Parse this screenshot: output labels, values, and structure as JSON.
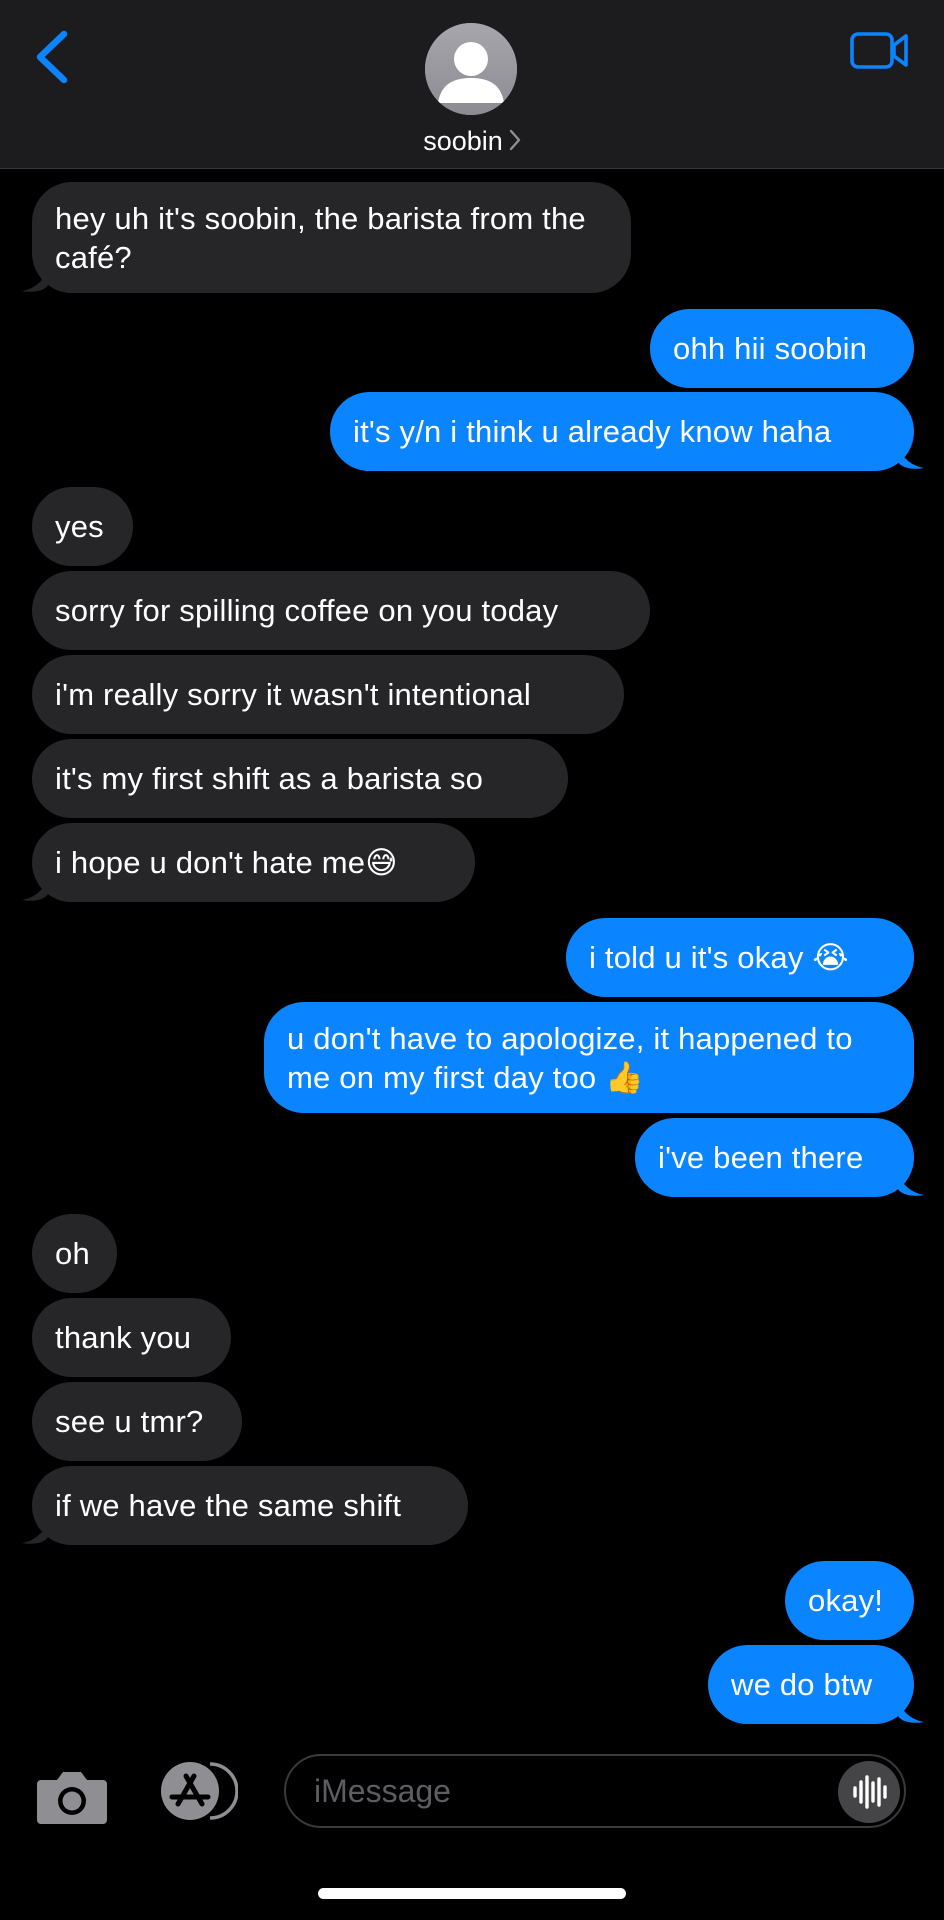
{
  "header": {
    "contact_name": "soobin",
    "back_icon": "chevron-left-icon",
    "video_icon": "video-camera-icon",
    "avatar_icon": "person-silhouette-icon"
  },
  "messages": [
    {
      "dir": "in",
      "text": "hey uh it's soobin, the barista from the café?"
    },
    {
      "dir": "out",
      "text": "ohh hii soobin"
    },
    {
      "dir": "out",
      "text": "it's y/n i think u already know haha"
    },
    {
      "dir": "in",
      "text": "yes"
    },
    {
      "dir": "in",
      "text": "sorry for spilling coffee on you today"
    },
    {
      "dir": "in",
      "text": "i'm really sorry it wasn't intentional"
    },
    {
      "dir": "in",
      "text": "it's my first shift as a barista so"
    },
    {
      "dir": "in",
      "text": "i hope u don't hate me😅"
    },
    {
      "dir": "out",
      "text": "i told u it's okay 😭"
    },
    {
      "dir": "out",
      "text": "u don't have to apologize, it happened to me on my first day too 👍"
    },
    {
      "dir": "out",
      "text": "i've been there"
    },
    {
      "dir": "in",
      "text": "oh"
    },
    {
      "dir": "in",
      "text": "thank you"
    },
    {
      "dir": "in",
      "text": "see u tmr?"
    },
    {
      "dir": "in",
      "text": "if we have the same shift"
    },
    {
      "dir": "out",
      "text": "okay!"
    },
    {
      "dir": "out",
      "text": "we do btw"
    }
  ],
  "composer": {
    "placeholder": "iMessage",
    "camera_icon": "camera-icon",
    "apps_icon": "app-store-icon",
    "audio_icon": "audio-waveform-icon"
  },
  "colors": {
    "outgoing_bubble": "#0a84ff",
    "incoming_bubble": "#262628",
    "header_bg": "#1c1c1e",
    "accent": "#0a84ff"
  }
}
